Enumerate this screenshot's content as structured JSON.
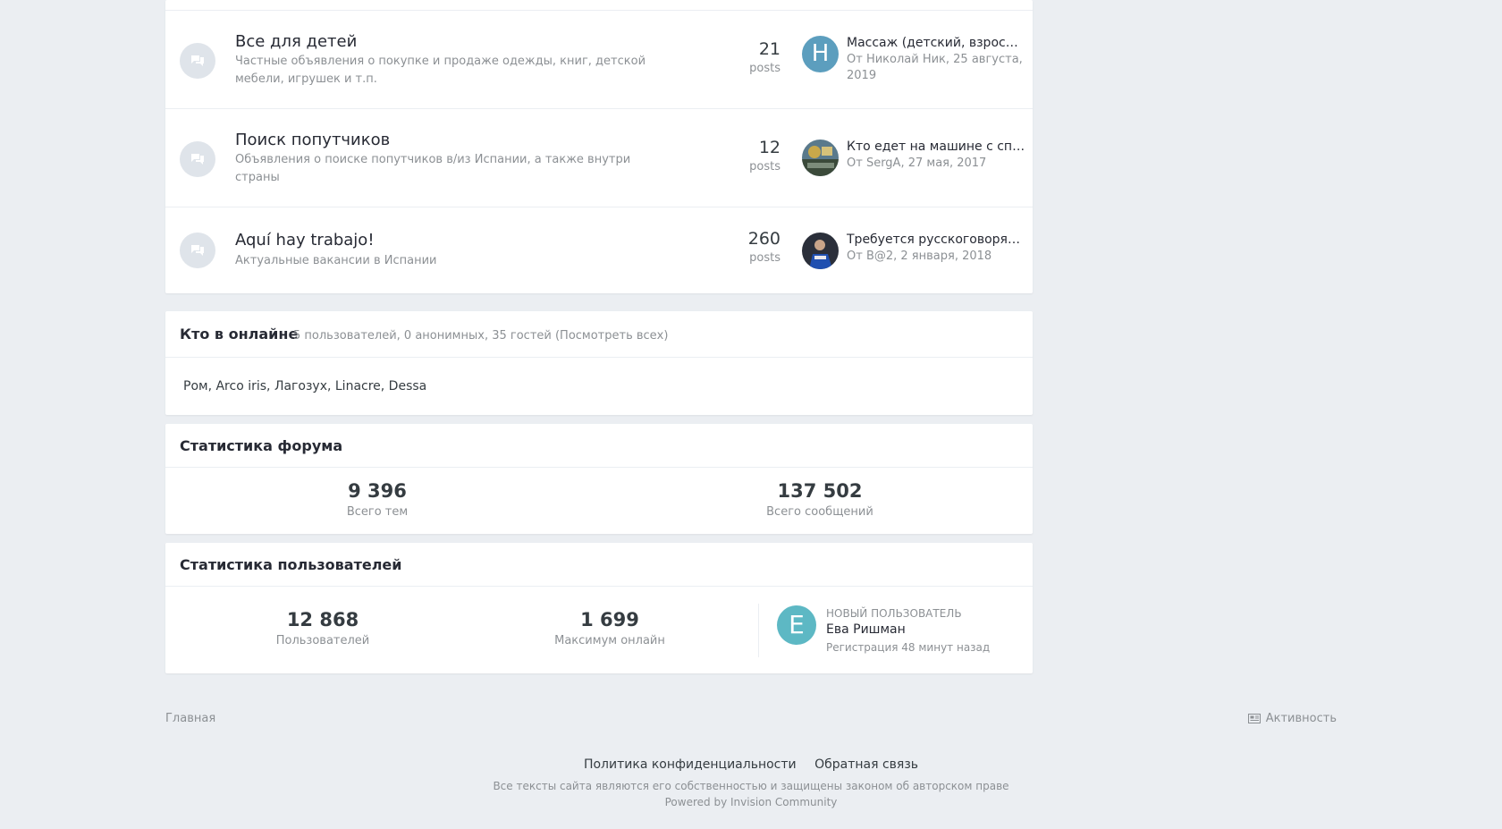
{
  "forums": [
    {
      "title": "Все для детей",
      "description": "Частные объявления о покупке и продаже одежды, книг, детской мебели, игрушек и т.п.",
      "posts": "21",
      "posts_label": "posts",
      "last_title": "Массаж (детский, взрослый) в Испании",
      "last_meta": "От Николай Ник, 25 августа, 2019",
      "avatar_letter": "Н"
    },
    {
      "title": "Поиск попутчиков",
      "description": "Объявления о поиске попутчиков в/из Испании, а также внутри страны",
      "posts": "12",
      "posts_label": "posts",
      "last_title": "Кто едет на машине с спб в Испанию",
      "last_meta": "От SergA, 27 мая, 2017"
    },
    {
      "title": "Aquí hay trabajo!",
      "description": "Актуальные вакансии в Испании",
      "posts": "260",
      "posts_label": "posts",
      "last_title": "Требуется русскоговорящий сотрудник",
      "last_meta": "От B@2, 2 января, 2018"
    }
  ],
  "online": {
    "title": "Кто в онлайне",
    "summary": "5 пользователей, 0 анонимных, 35 гостей (Посмотреть всех)",
    "users": "Ром, Arco iris, Лагозух, Linacre, Dessa"
  },
  "forum_stats": {
    "title": "Статистика форума",
    "topics_value": "9 396",
    "topics_label": "Всего тем",
    "posts_value": "137 502",
    "posts_label": "Всего сообщений"
  },
  "user_stats": {
    "title": "Статистика пользователей",
    "members_value": "12 868",
    "members_label": "Пользователей",
    "max_online_value": "1 699",
    "max_online_label": "Максимум онлайн",
    "new_member_label": "Новый пользователь",
    "new_member_name": "Ева Ришман",
    "new_member_letter": "Е",
    "new_member_reg": "Регистрация 48 минут назад"
  },
  "breadcrumb": {
    "home": "Главная",
    "activity": "Активность"
  },
  "footer": {
    "privacy": "Политика конфиденциальности",
    "contact": "Обратная связь",
    "copyright": "Все тексты сайта являются его собственностью и защищены законом об авторском праве",
    "powered": "Powered by Invision Community"
  },
  "colors": {
    "background": "#ebeef2",
    "card": "#ffffff",
    "muted_text": "#8c9094",
    "avatar_blue": "#5c9ebe",
    "avatar_teal": "#5db8c4"
  }
}
